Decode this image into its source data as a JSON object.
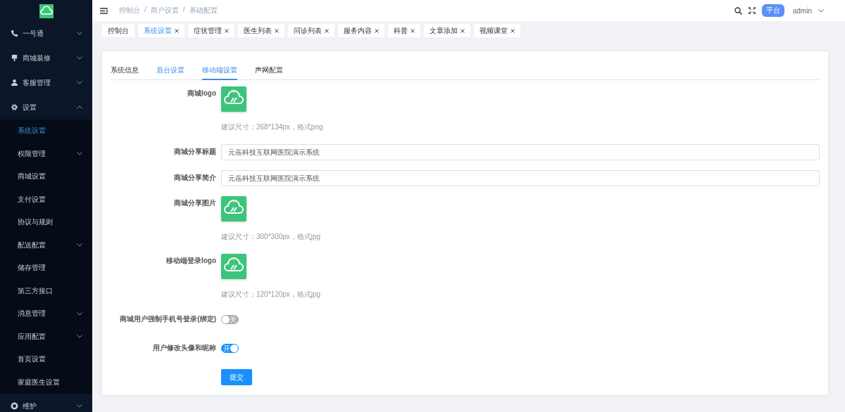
{
  "sidebar": {
    "items": [
      {
        "label": "一号通",
        "kind": "group",
        "expanded": false
      },
      {
        "label": "商城装修",
        "kind": "group",
        "expanded": false
      },
      {
        "label": "客服管理",
        "kind": "group",
        "expanded": false
      },
      {
        "label": "设置",
        "kind": "group",
        "expanded": true,
        "children": [
          {
            "label": "系统设置",
            "kind": "link",
            "selected": true
          },
          {
            "label": "权限管理",
            "kind": "group",
            "expanded": false,
            "selected": false
          },
          {
            "label": "商城设置",
            "kind": "link",
            "selected": false
          },
          {
            "label": "支付设置",
            "kind": "link",
            "selected": false
          },
          {
            "label": "协议与规则",
            "kind": "link",
            "selected": false
          },
          {
            "label": "配送配置",
            "kind": "group",
            "expanded": false,
            "selected": false
          },
          {
            "label": "储存管理",
            "kind": "link",
            "selected": false
          },
          {
            "label": "第三方接口",
            "kind": "link",
            "selected": false
          },
          {
            "label": "消息管理",
            "kind": "group",
            "expanded": false,
            "selected": false
          },
          {
            "label": "应用配置",
            "kind": "group",
            "expanded": false,
            "selected": false
          },
          {
            "label": "首页设置",
            "kind": "link",
            "selected": false
          },
          {
            "label": "家庭医生设置",
            "kind": "link",
            "selected": false
          }
        ]
      },
      {
        "label": "维护",
        "kind": "group",
        "expanded": false
      }
    ]
  },
  "header": {
    "breadcrumb": [
      "控制台",
      "商户设置",
      "基础配置"
    ],
    "separator": "/",
    "badge": "平台",
    "user": "admin"
  },
  "tags": [
    {
      "label": "控制台",
      "closable": false,
      "selected": false
    },
    {
      "label": "系统设置",
      "closable": true,
      "selected": true
    },
    {
      "label": "症状管理",
      "closable": true,
      "selected": false
    },
    {
      "label": "医生列表",
      "closable": true,
      "selected": false
    },
    {
      "label": "问诊列表",
      "closable": true,
      "selected": false
    },
    {
      "label": "服务内容",
      "closable": true,
      "selected": false
    },
    {
      "label": "科普",
      "closable": true,
      "selected": false
    },
    {
      "label": "文章添加",
      "closable": true,
      "selected": false
    },
    {
      "label": "视频课堂",
      "closable": true,
      "selected": false
    }
  ],
  "tabs": [
    {
      "label": "系统信息",
      "selected": false,
      "hovered": false
    },
    {
      "label": "后台设置",
      "selected": false,
      "hovered": true
    },
    {
      "label": "移动端设置",
      "selected": true,
      "hovered": false
    },
    {
      "label": "声网配置",
      "selected": false,
      "hovered": false
    }
  ],
  "form": [
    {
      "kind": "image",
      "label": "商城logo",
      "hint": "建议尺寸：268*134px，格式png"
    },
    {
      "kind": "input",
      "label": "商城分享标题",
      "value": "元岳科技互联网医院演示系统"
    },
    {
      "kind": "input",
      "label": "商城分享简介",
      "value": "元岳科技互联网医院演示系统"
    },
    {
      "kind": "image",
      "label": "商城分享图片",
      "hint": "建议尺寸：300*300px，格式jpg"
    },
    {
      "kind": "image",
      "label": "移动端登录logo",
      "hint": "建议尺寸：120*120px，格式jpg"
    },
    {
      "kind": "switch",
      "label": "商城用户强制手机号登录(绑定)",
      "on": false,
      "text": "关"
    },
    {
      "kind": "switch",
      "label": "用户修改头像和昵称",
      "on": true,
      "text": "开"
    }
  ],
  "submit": "提交"
}
